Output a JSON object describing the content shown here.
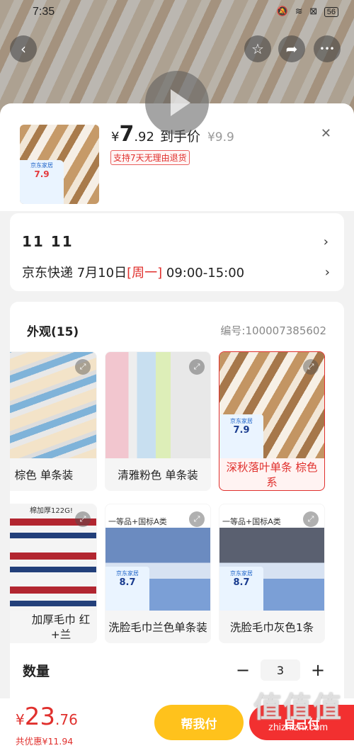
{
  "statusbar": {
    "time": "7:35",
    "icons": "🔕 ≋ ⊠",
    "battery": "56"
  },
  "nav": {
    "back": "‹",
    "star": "☆",
    "share": "➦",
    "more": "•••"
  },
  "product": {
    "currency": "¥",
    "price_int": "7",
    "price_dec": ".92",
    "price_tag": "到手价",
    "original_price": "¥9.9",
    "return_policy": "支持7天无理由退货",
    "close": "✕",
    "thumb_badge_title": "京东家居",
    "thumb_badge_price": "7.9"
  },
  "delivery": {
    "date_line": "11 11",
    "carrier": "京东快递",
    "date": "7月10日",
    "weekday": "[周一]",
    "time_window": "09:00-15:00",
    "chevron": "›"
  },
  "spec": {
    "title": "外观(15)",
    "code": "编号:100007385602",
    "expand_icon": "⤢",
    "options": [
      {
        "label": "棕色 单条装",
        "selected": false
      },
      {
        "label": "清雅粉色 单条装",
        "selected": false
      },
      {
        "label": "深秋落叶单条 棕色系",
        "selected": true
      },
      {
        "label": "加厚毛巾 红+兰",
        "selected": false,
        "overlay": "棉加厚122G!"
      },
      {
        "label": "洗脸毛巾兰色单条装",
        "selected": false,
        "overlay": "一等品+国标A类",
        "badge_title": "京东家居",
        "badge_price": "8.7"
      },
      {
        "label": "洗脸毛巾灰色1条",
        "selected": false,
        "overlay": "一等品+国标A类",
        "badge_title": "京东家居",
        "badge_price": "8.7"
      }
    ]
  },
  "quantity": {
    "label": "数量",
    "minus": "−",
    "value": "3",
    "plus": "+"
  },
  "bottom": {
    "currency": "¥",
    "total_int": "23",
    "total_dec": ".76",
    "saving": "共优惠¥11.94",
    "help_pay": "帮我付",
    "self_pay": "自己付"
  },
  "watermark": {
    "big": "值值值",
    "small": "zhizhizhi.com"
  }
}
